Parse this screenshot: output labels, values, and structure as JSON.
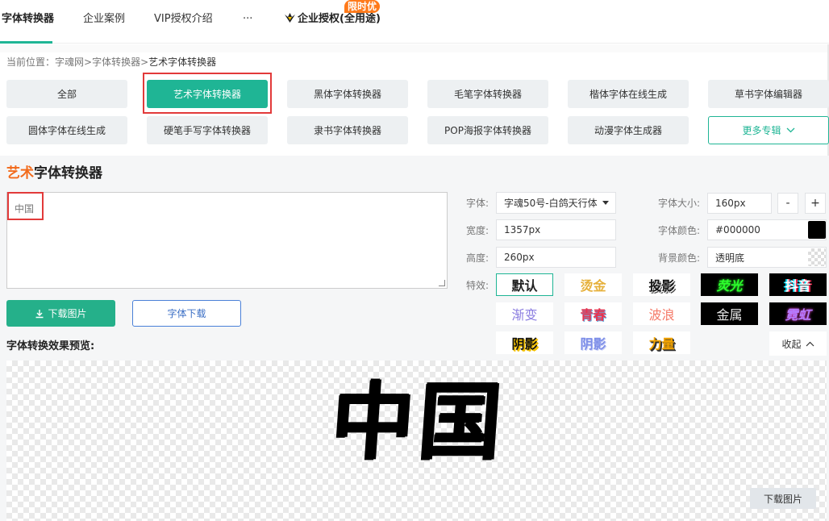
{
  "nav": {
    "items": [
      "字体转换器",
      "企业案例",
      "VIP授权介绍",
      "···"
    ],
    "enterprise_label": "企业授权(全用途)",
    "promo_badge": "限时优"
  },
  "breadcrumb": {
    "prefix": "当前位置：",
    "path": "字魂网>字体转换器>",
    "current": "艺术字体转换器"
  },
  "categories": {
    "row1": [
      "全部",
      "艺术字体转换器",
      "黑体字体转换器",
      "毛笔字体转换器",
      "楷体字体在线生成",
      "草书字体编辑器"
    ],
    "row2": [
      "圆体字体在线生成",
      "硬笔手写字体转换器",
      "隶书字体转换器",
      "POP海报字体转换器",
      "动漫字体生成器"
    ],
    "more": "更多专辑"
  },
  "tool": {
    "title_highlight": "艺术",
    "title_rest": "字体转换器",
    "input_text": "中国",
    "download_image": "下载图片",
    "font_download": "字体下载",
    "preview_label": "字体转换效果预览:"
  },
  "settings": {
    "font_label": "字体:",
    "font_value": "字魂50号-白鸽天行体",
    "width_label": "宽度:",
    "width_value": "1357px",
    "height_label": "高度:",
    "height_value": "260px",
    "effects_label": "特效:",
    "size_label": "字体大小:",
    "size_value": "160px",
    "minus": "-",
    "plus": "+",
    "color_label": "字体颜色:",
    "color_value": "#000000",
    "bg_label": "背景颜色:",
    "bg_value": "透明底",
    "collapse": "收起"
  },
  "effects": [
    "默认",
    "烫金",
    "投影",
    "荧光",
    "抖音",
    "渐变",
    "青春",
    "波浪",
    "金属",
    "霓虹",
    "阴影",
    "阴影",
    "力量"
  ],
  "preview": {
    "text": "中国",
    "download_button": "下载图片"
  },
  "colors": {
    "accent": "#1fb595",
    "title_highlight": "#f26a1b",
    "promo": "#ff7a1a",
    "highlight_box": "#e23a3a"
  }
}
